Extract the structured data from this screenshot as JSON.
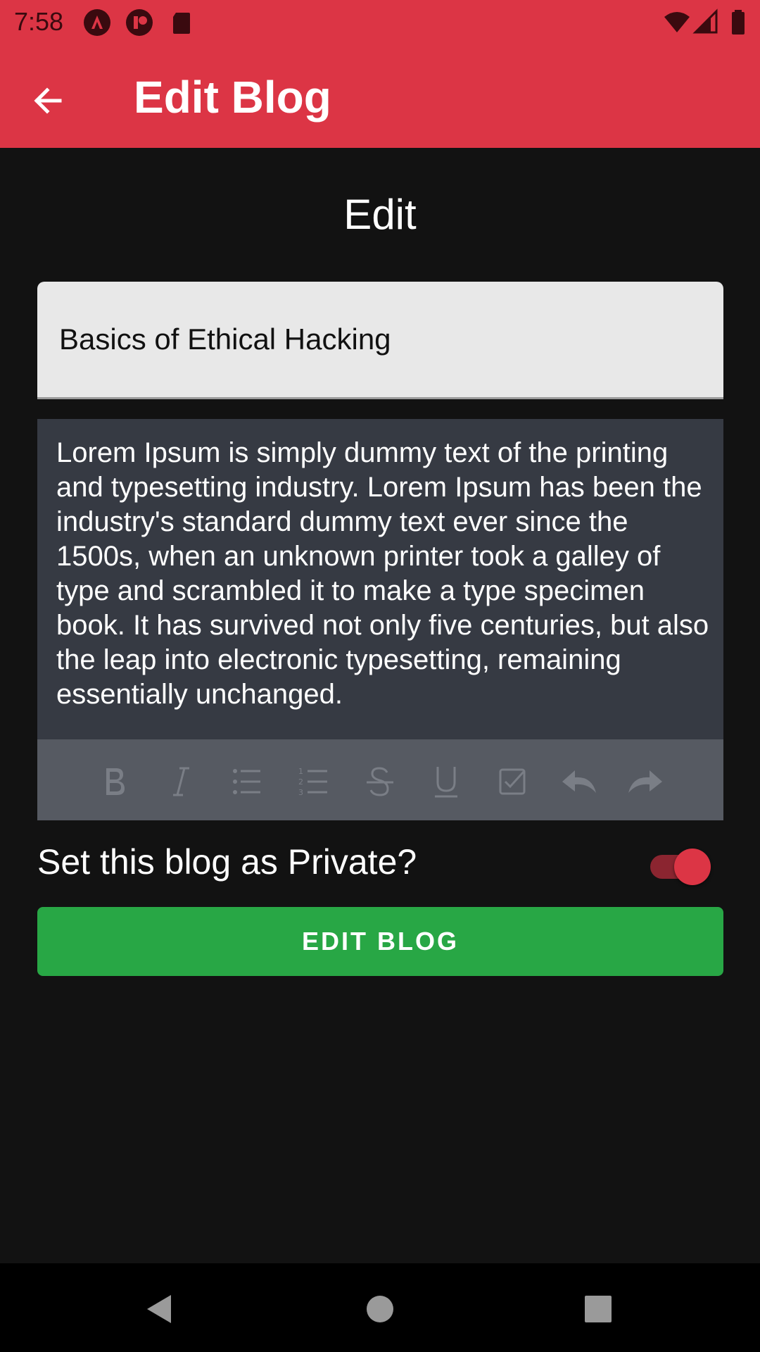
{
  "status_bar": {
    "time": "7:58",
    "icons": [
      "angular-notification-icon",
      "app-notification-icon",
      "sd-card-icon",
      "wifi-icon",
      "signal-icon",
      "battery-icon"
    ]
  },
  "app_bar": {
    "title": "Edit Blog",
    "back_icon": "arrow-back-icon"
  },
  "form": {
    "heading": "Edit",
    "title_value": "Basics of Ethical Hacking",
    "body_text": "Lorem Ipsum is simply dummy text of the printing and typesetting industry. Lorem Ipsum has been the industry's standard dummy text ever since the 1500s, when an unknown printer took a galley of type and scrambled it to make a type specimen book. It has survived not only five centuries, but also the leap into electronic typesetting, remaining essentially unchanged.",
    "toolbar_tools": [
      "bold-icon",
      "italic-icon",
      "bullet-list-icon",
      "numbered-list-icon",
      "strikethrough-icon",
      "underline-icon",
      "checkbox-icon",
      "undo-icon",
      "redo-icon"
    ],
    "private_label": "Set this blog as Private?",
    "private_enabled": true,
    "submit_label": "EDIT BLOG"
  },
  "colors": {
    "accent": "#DC3545",
    "button": "#28A745",
    "background": "#121212",
    "editor_bg": "#363A43",
    "toolbar_bg": "#565A62"
  },
  "nav_bar": {
    "buttons": [
      "back-triangle-icon",
      "home-circle-icon",
      "recents-square-icon"
    ]
  }
}
